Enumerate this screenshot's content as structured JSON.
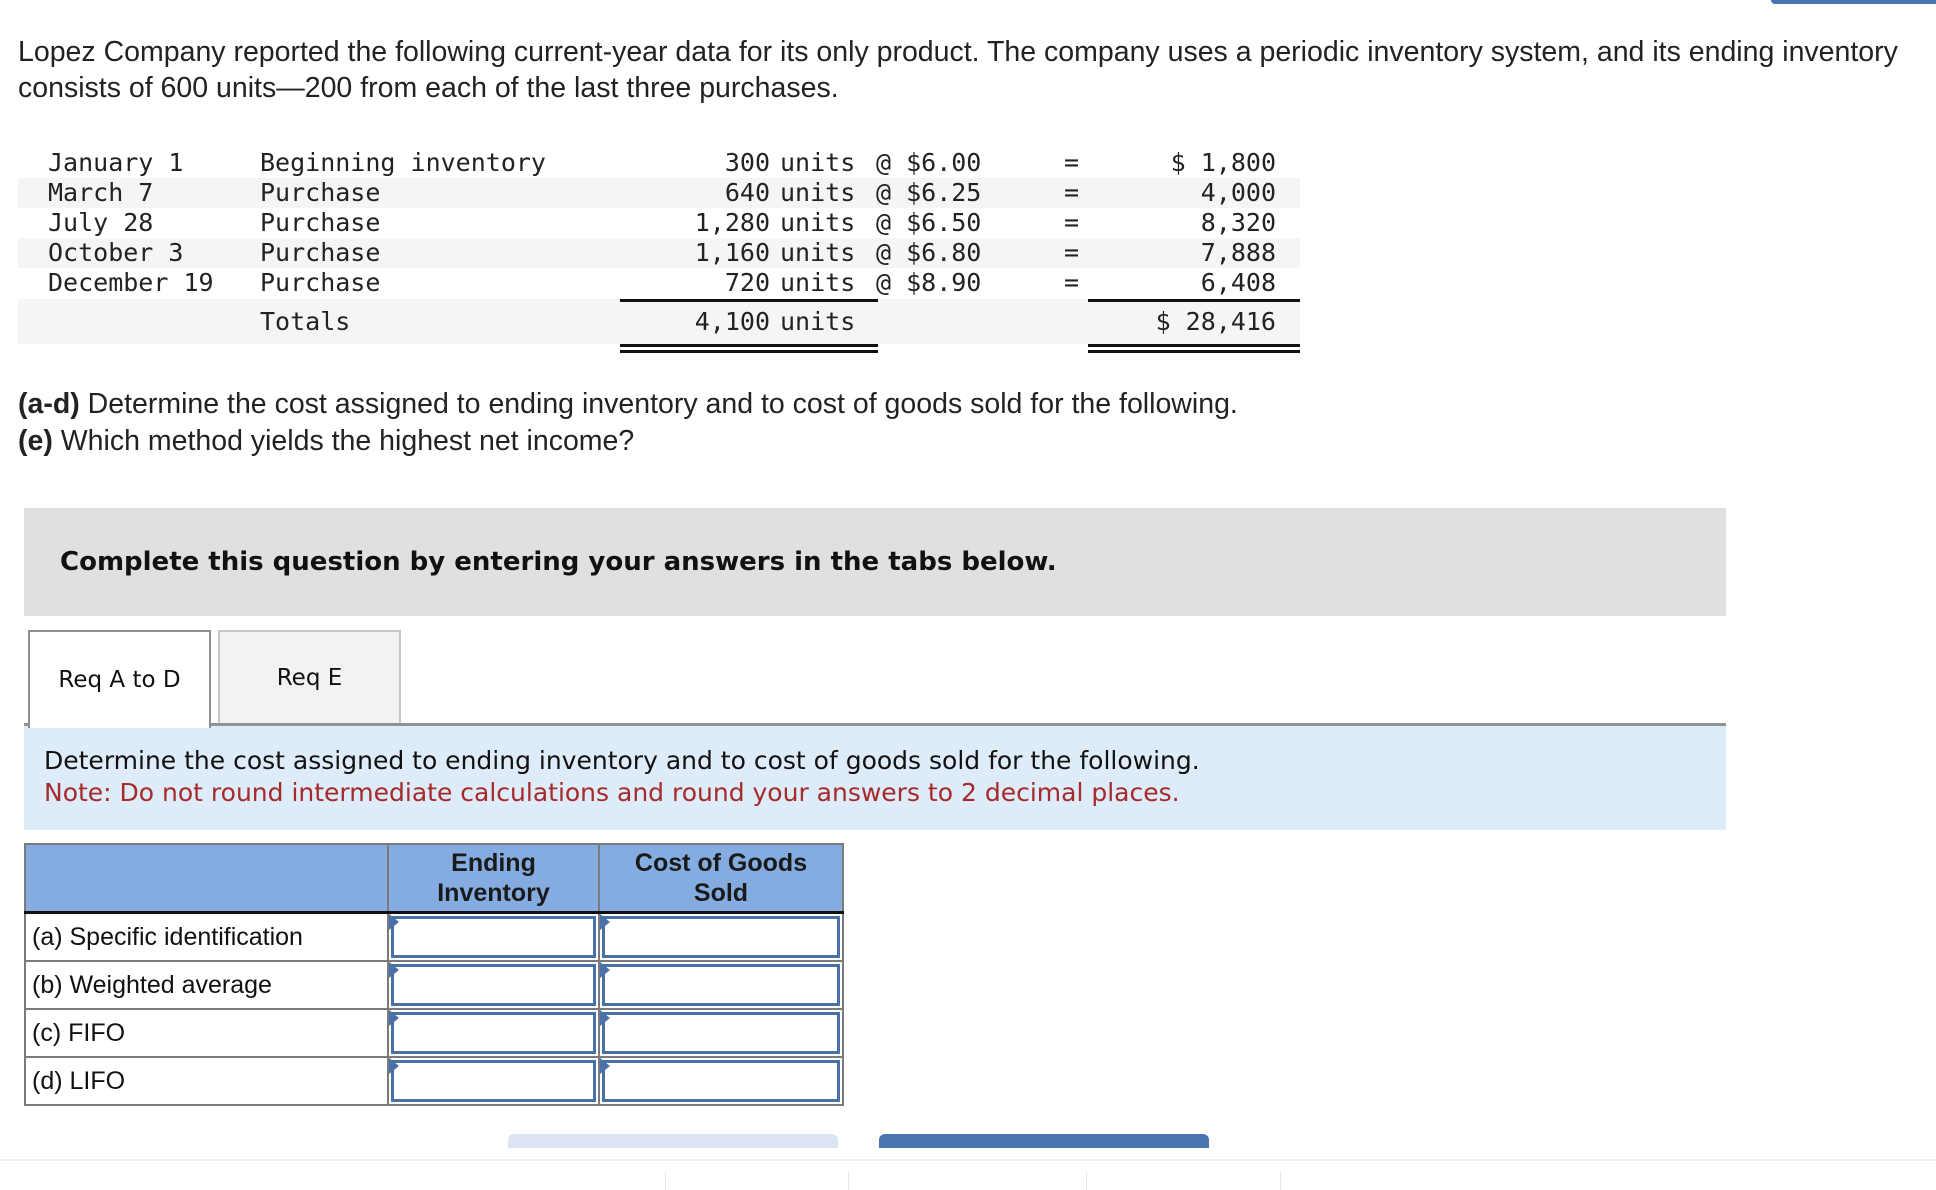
{
  "intro": "Lopez Company reported the following current-year data for its only product. The company uses a periodic inventory system, and its ending inventory consists of 600 units—200 from each of the last three purchases.",
  "inventory": {
    "rows": [
      {
        "date": "January 1",
        "desc": "Beginning inventory",
        "qty": "300",
        "unit": "units",
        "cost": "@ $6.00",
        "eq": "=",
        "amount": "$ 1,800"
      },
      {
        "date": "March 7",
        "desc": "Purchase",
        "qty": "640",
        "unit": "units",
        "cost": "@ $6.25",
        "eq": "=",
        "amount": "4,000"
      },
      {
        "date": "July 28",
        "desc": "Purchase",
        "qty": "1,280",
        "unit": "units",
        "cost": "@ $6.50",
        "eq": "=",
        "amount": "8,320"
      },
      {
        "date": "October 3",
        "desc": "Purchase",
        "qty": "1,160",
        "unit": "units",
        "cost": "@ $6.80",
        "eq": "=",
        "amount": "7,888"
      },
      {
        "date": "December 19",
        "desc": "Purchase",
        "qty": "720",
        "unit": "units",
        "cost": "@ $8.90",
        "eq": "=",
        "amount": "6,408"
      }
    ],
    "totals": {
      "desc": "Totals",
      "qty": "4,100",
      "unit": "units",
      "amount": "$ 28,416"
    }
  },
  "questions": {
    "ad_label": "(a-d)",
    "ad_text": " Determine the cost assigned to ending inventory and to cost of goods sold for the following.",
    "e_label": "(e)",
    "e_text": " Which method yields the highest net income?"
  },
  "instruction": "Complete this question by entering your answers in the tabs below.",
  "tabs": [
    {
      "label": "Req A to D",
      "active": true
    },
    {
      "label": "Req E",
      "active": false
    }
  ],
  "panel": {
    "text": "Determine the cost assigned to ending inventory and to cost of goods sold for the following.",
    "note": "Note: Do not round intermediate calculations and round your answers to 2 decimal places."
  },
  "answer_table": {
    "headers": [
      "",
      "Ending Inventory",
      "Cost of Goods Sold"
    ],
    "rows": [
      {
        "label": "(a) Specific identification",
        "ending_inventory": "",
        "cogs": ""
      },
      {
        "label": "(b) Weighted average",
        "ending_inventory": "",
        "cogs": ""
      },
      {
        "label": "(c) FIFO",
        "ending_inventory": "",
        "cogs": ""
      },
      {
        "label": "(d) LIFO",
        "ending_inventory": "",
        "cogs": ""
      }
    ]
  },
  "colors": {
    "accent": "#4a74b0",
    "header_blue": "#84ace0",
    "panel_blue": "#deebf8",
    "note_red": "#a52a2a",
    "instruction_gray": "#e0e0e0"
  }
}
